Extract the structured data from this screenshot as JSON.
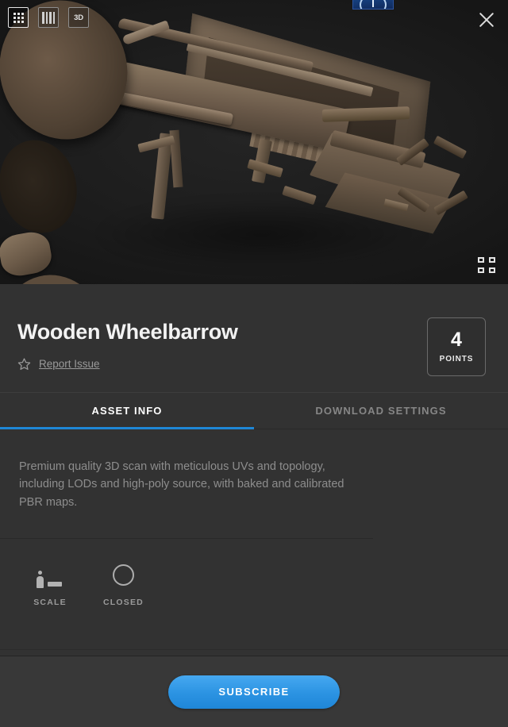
{
  "viewer": {
    "view_modes": [
      {
        "name": "grid-view",
        "icon": "grid-icon",
        "active": true
      },
      {
        "name": "columns-view",
        "icon": "columns-icon",
        "active": false
      },
      {
        "name": "three-d-view",
        "icon": "3d-icon",
        "label": "3D",
        "active": false
      }
    ],
    "close_icon": "close-icon",
    "fullscreen_icon": "fullscreen-icon",
    "logo_badge": "brand-logo-icon",
    "model_alt": "Wooden Wheelbarrow 3D scan"
  },
  "asset": {
    "title": "Wooden Wheelbarrow",
    "favorite_icon": "star-icon",
    "report_link": "Report Issue",
    "points_value": "4",
    "points_label": "POINTS"
  },
  "tabs": [
    {
      "label": "ASSET INFO",
      "active": true
    },
    {
      "label": "DOWNLOAD SETTINGS",
      "active": false
    }
  ],
  "description": "Premium quality 3D scan with meticulous UVs and topology, including LODs and high-poly source, with baked and calibrated PBR maps.",
  "attributes": [
    {
      "label": "SCALE",
      "icon": "scale-person-icon"
    },
    {
      "label": "CLOSED",
      "icon": "circle-closed-icon"
    }
  ],
  "footer": {
    "subscribe_label": "SUBSCRIBE"
  },
  "colors": {
    "accent": "#1e87d6",
    "subscribe": "#2b93e2",
    "panel_bg": "#323232",
    "viewer_bg": "#1b1b1b",
    "bottom_bar_bg": "#383838",
    "muted_text": "#8d8d8d"
  }
}
